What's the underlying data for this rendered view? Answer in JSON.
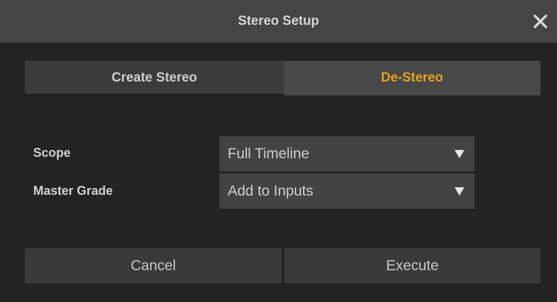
{
  "dialog": {
    "title": "Stereo Setup",
    "close_icon": "close-icon"
  },
  "tabs": [
    {
      "label": "Create Stereo",
      "active": false
    },
    {
      "label": "De-Stereo",
      "active": true
    }
  ],
  "colors": {
    "active_tab_text": "#e4a320",
    "title_bar": "#454545",
    "background": "#232323"
  },
  "fields": {
    "scope": {
      "label": "Scope",
      "value": "Full Timeline",
      "icon": "triangle-down-icon"
    },
    "master_grade": {
      "label": "Master Grade",
      "value": "Add to Inputs",
      "icon": "triangle-down-icon"
    }
  },
  "actions": {
    "cancel_label": "Cancel",
    "execute_label": "Execute"
  }
}
